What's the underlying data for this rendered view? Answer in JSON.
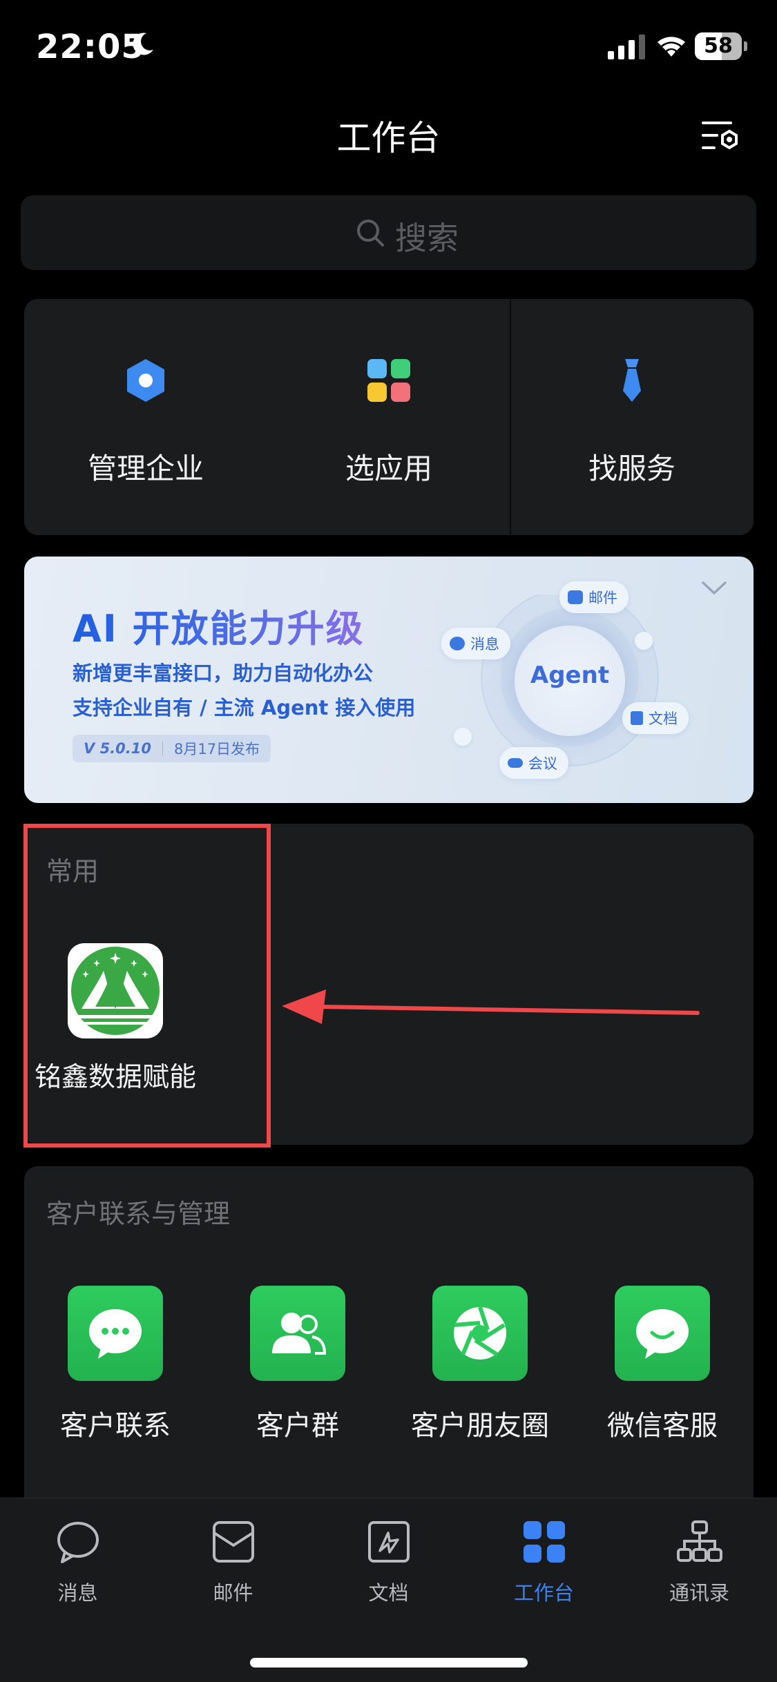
{
  "status_bar": {
    "time": "22:05",
    "battery": "58",
    "battery_level": 0.58
  },
  "header": {
    "title": "工作台"
  },
  "search": {
    "placeholder": "搜索"
  },
  "quick_actions": [
    {
      "label": "管理企业",
      "icon": "hexagon-settings-icon"
    },
    {
      "label": "选应用",
      "icon": "app-grid-icon"
    },
    {
      "label": "找服务",
      "icon": "tie-icon"
    }
  ],
  "banner": {
    "title": "AI 开放能力升级",
    "line1": "新增更丰富接口，助力自动化办公",
    "line2": "支持企业自有 / 主流 Agent 接入使用",
    "version": "V 5.0.10",
    "release": "8月17日发布",
    "center": "Agent",
    "chips": {
      "mail": "邮件",
      "message": "消息",
      "doc": "文档",
      "meeting": "会议"
    }
  },
  "frequent": {
    "title": "常用",
    "app_label": "铭鑫数据赋能"
  },
  "customer": {
    "title": "客户联系与管理",
    "items": [
      {
        "label": "客户联系",
        "icon": "chat-bubble-icon"
      },
      {
        "label": "客户群",
        "icon": "group-icon"
      },
      {
        "label": "客户朋友圈",
        "icon": "aperture-icon"
      },
      {
        "label": "微信客服",
        "icon": "smile-bubble-icon"
      }
    ]
  },
  "tabs": [
    {
      "label": "消息",
      "icon": "message-icon",
      "active": false
    },
    {
      "label": "邮件",
      "icon": "mail-icon",
      "active": false
    },
    {
      "label": "文档",
      "icon": "document-icon",
      "active": false
    },
    {
      "label": "工作台",
      "icon": "workbench-icon",
      "active": true
    },
    {
      "label": "通讯录",
      "icon": "contacts-icon",
      "active": false
    }
  ],
  "colors": {
    "accent": "#3b82f6",
    "highlight": "#f0474a",
    "green": "#2ecc5e"
  }
}
